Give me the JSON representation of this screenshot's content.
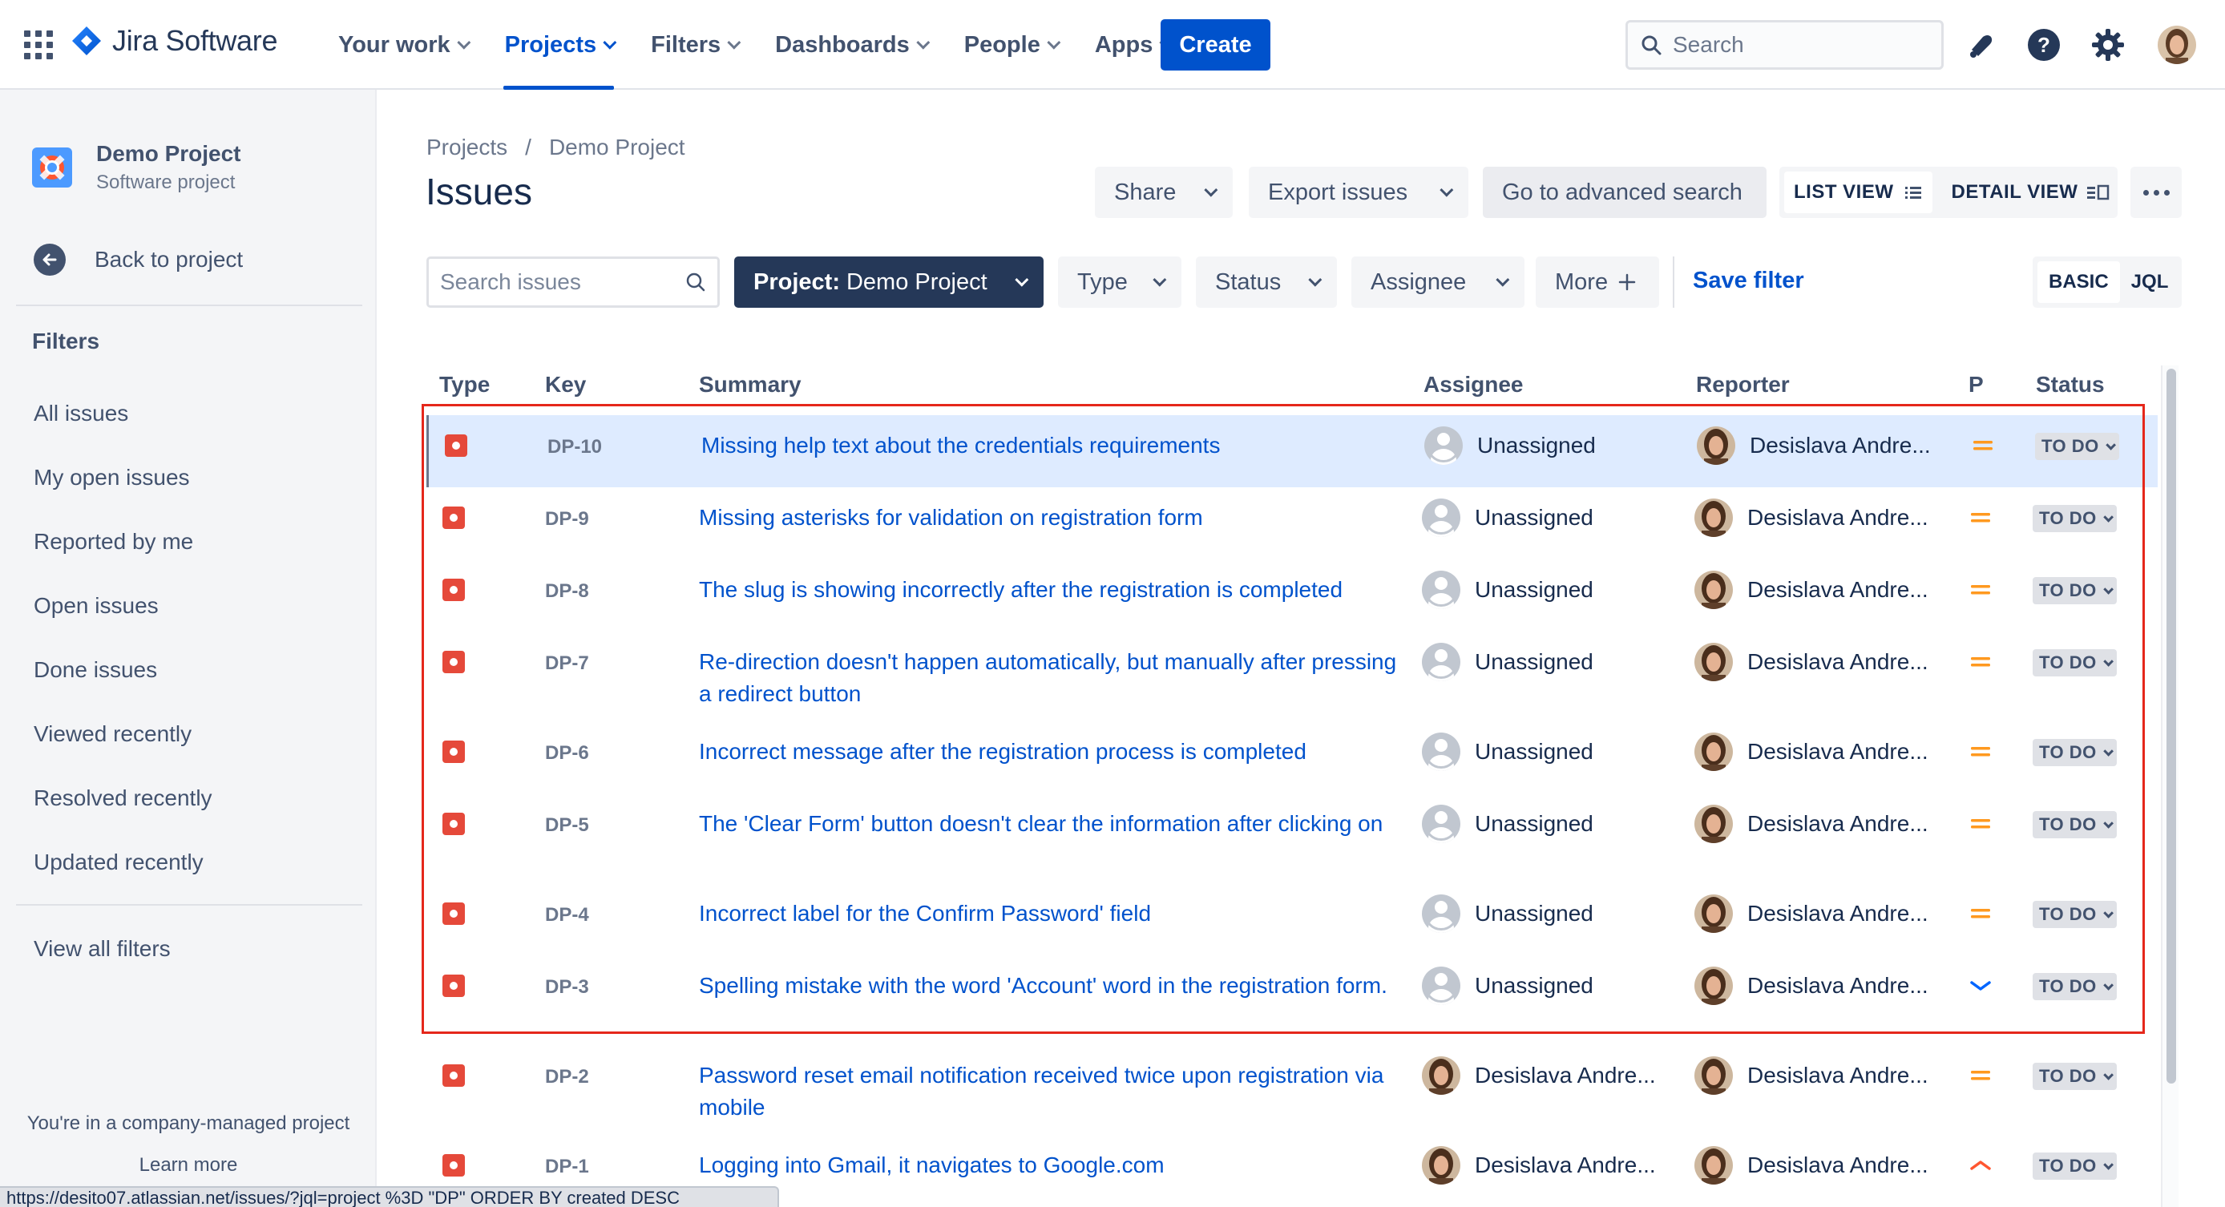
{
  "topnav": {
    "brand": "Jira Software",
    "items": [
      {
        "label": "Your work",
        "active": false
      },
      {
        "label": "Projects",
        "active": true
      },
      {
        "label": "Filters",
        "active": false
      },
      {
        "label": "Dashboards",
        "active": false
      },
      {
        "label": "People",
        "active": false
      },
      {
        "label": "Apps",
        "active": false
      }
    ],
    "create_label": "Create",
    "search_placeholder": "Search"
  },
  "sidebar": {
    "project_name": "Demo Project",
    "project_type": "Software project",
    "back_label": "Back to project",
    "filters_heading": "Filters",
    "items": [
      {
        "label": "All issues"
      },
      {
        "label": "My open issues"
      },
      {
        "label": "Reported by me"
      },
      {
        "label": "Open issues"
      },
      {
        "label": "Done issues"
      },
      {
        "label": "Viewed recently"
      },
      {
        "label": "Resolved recently"
      },
      {
        "label": "Updated recently"
      }
    ],
    "view_all": "View all filters",
    "footer_text": "You're in a company-managed project",
    "learn_more": "Learn more",
    "status_url": "https://desito07.atlassian.net/issues/?jql=project %3D \"DP\" ORDER BY created DESC"
  },
  "header": {
    "breadcrumb": [
      "Projects",
      "Demo Project"
    ],
    "breadcrumb_sep": "/",
    "title": "Issues",
    "share_label": "Share",
    "export_label": "Export issues",
    "advanced_label": "Go to advanced search",
    "list_view_label": "LIST VIEW",
    "detail_view_label": "DETAIL VIEW"
  },
  "filters": {
    "search_placeholder": "Search issues",
    "project_prefix": "Project:",
    "project_value": "Demo Project",
    "type_label": "Type",
    "status_label": "Status",
    "assignee_label": "Assignee",
    "more_label": "More",
    "save_filter_label": "Save filter",
    "basic_label": "BASIC",
    "jql_label": "JQL"
  },
  "table": {
    "columns": [
      "Type",
      "Key",
      "Summary",
      "Assignee",
      "Reporter",
      "P",
      "Status"
    ],
    "rows": [
      {
        "key": "DP-10",
        "summary": "Missing help text about the credentials requirements",
        "assignee": "Unassigned",
        "reporter": "Desislava Andre...",
        "priority": "medium",
        "status": "TO DO"
      },
      {
        "key": "DP-9",
        "summary": "Missing asterisks for validation on registration form",
        "assignee": "Unassigned",
        "reporter": "Desislava Andre...",
        "priority": "medium",
        "status": "TO DO"
      },
      {
        "key": "DP-8",
        "summary": "The slug is showing incorrectly after the registration is completed",
        "assignee": "Unassigned",
        "reporter": "Desislava Andre...",
        "priority": "medium",
        "status": "TO DO"
      },
      {
        "key": "DP-7",
        "summary": "Re-direction doesn't happen automatically, but manually after pressing a redirect button",
        "assignee": "Unassigned",
        "reporter": "Desislava Andre...",
        "priority": "medium",
        "status": "TO DO"
      },
      {
        "key": "DP-6",
        "summary": "Incorrect message after the registration process is completed",
        "assignee": "Unassigned",
        "reporter": "Desislava Andre...",
        "priority": "medium",
        "status": "TO DO"
      },
      {
        "key": "DP-5",
        "summary": "The 'Clear Form' button doesn't clear the information after clicking on",
        "assignee": "Unassigned",
        "reporter": "Desislava Andre...",
        "priority": "medium",
        "status": "TO DO"
      },
      {
        "key": "DP-4",
        "summary": "Incorrect label for the Confirm Password' field",
        "assignee": "Unassigned",
        "reporter": "Desislava Andre...",
        "priority": "medium",
        "status": "TO DO"
      },
      {
        "key": "DP-3",
        "summary": "Spelling mistake with the word 'Account' word in the registration form.",
        "assignee": "Unassigned",
        "reporter": "Desislava Andre...",
        "priority": "low",
        "status": "TO DO"
      },
      {
        "key": "DP-2",
        "summary": "Password reset email notification received twice upon registration via mobile",
        "assignee": "Desislava Andre...",
        "reporter": "Desislava Andre...",
        "priority": "medium",
        "status": "TO DO"
      },
      {
        "key": "DP-1",
        "summary": "Logging into Gmail, it navigates to Google.com",
        "assignee": "Desislava Andre...",
        "reporter": "Desislava Andre...",
        "priority": "high",
        "status": "TO DO"
      }
    ]
  },
  "colors": {
    "primary": "#0052cc",
    "bug": "#e5493a",
    "priority_medium": "#ff991f",
    "priority_low": "#0065ff",
    "priority_high": "#ff5630",
    "highlight_box": "#e5271b",
    "selected_row": "#deebff"
  }
}
